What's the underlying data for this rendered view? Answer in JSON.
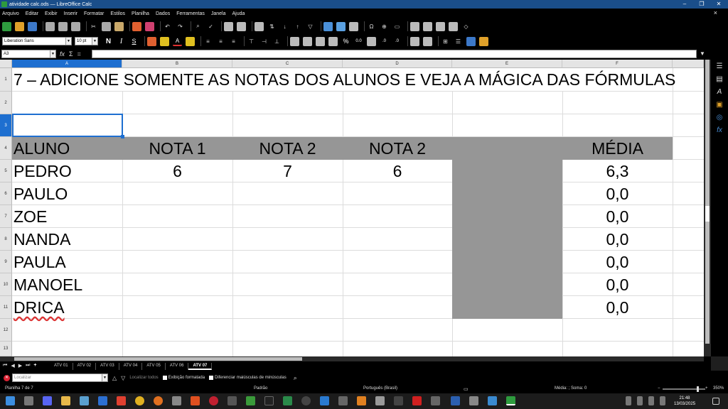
{
  "window": {
    "title": "atividade calc.ods — LibreOffice Calc",
    "controls": [
      "–",
      "❐",
      "✕"
    ]
  },
  "menu": [
    "Arquivo",
    "Editar",
    "Exibir",
    "Inserir",
    "Formatar",
    "Estilos",
    "Planilha",
    "Dados",
    "Ferramentas",
    "Janela",
    "Ajuda"
  ],
  "formatting": {
    "font_name": "Liberation Sans",
    "font_size": "10 pt",
    "bold": "N",
    "italic": "I",
    "underline": "S",
    "percent": "%",
    "decimal": "0.0"
  },
  "formula_bar": {
    "name_box": "A3",
    "fx": "fx",
    "sigma": "Σ",
    "equals": "=",
    "content": ""
  },
  "columns": [
    "A",
    "B",
    "C",
    "D",
    "E",
    "F"
  ],
  "rows": [
    "1",
    "2",
    "3",
    "4",
    "5",
    "6",
    "7",
    "8",
    "9",
    "10",
    "11",
    "12",
    "13"
  ],
  "sheet": {
    "title": "7 – ADICIONE SOMENTE AS NOTAS DOS ALUNOS E VEJA A MÁGICA DAS FÓRMULAS",
    "headers": [
      "ALUNO",
      "NOTA 1",
      "NOTA 2",
      "NOTA 2",
      "",
      "MÉDIA"
    ],
    "students": [
      {
        "name": "PEDRO",
        "n1": "6",
        "n2": "7",
        "n3": "6",
        "media": "6,3"
      },
      {
        "name": "PAULO",
        "n1": "",
        "n2": "",
        "n3": "",
        "media": "0,0"
      },
      {
        "name": "ZOE",
        "n1": "",
        "n2": "",
        "n3": "",
        "media": "0,0"
      },
      {
        "name": "NANDA",
        "n1": "",
        "n2": "",
        "n3": "",
        "media": "0,0"
      },
      {
        "name": "PAULA",
        "n1": "",
        "n2": "",
        "n3": "",
        "media": "0,0"
      },
      {
        "name": "MANOEL",
        "n1": "",
        "n2": "",
        "n3": "",
        "media": "0,0"
      },
      {
        "name": "DRICA",
        "n1": "",
        "n2": "",
        "n3": "",
        "media": "0,0"
      }
    ]
  },
  "tabs": [
    "ATV 01",
    "ATV 02",
    "ATV 03",
    "ATV 04",
    "ATV 05",
    "ATV 06",
    "ATV 07"
  ],
  "active_tab": "ATV 07",
  "find": {
    "placeholder": "Localizar",
    "find_all": "Localizar todos",
    "formatted": "Exibição formatada",
    "match_case": "Diferenciar maiúsculas de minúsculas"
  },
  "status": {
    "sheet": "Planilha 7 de 7",
    "style": "Padrão",
    "language": "Português (Brasil)",
    "summary": "Média: ; Soma: 0",
    "zoom": "350%"
  },
  "clock": {
    "time": "21:48",
    "date": "13/03/2025"
  },
  "colors": {
    "accent": "#1e6fd0",
    "header_gray": "#969696",
    "title_bar": "#1a4e8a"
  }
}
